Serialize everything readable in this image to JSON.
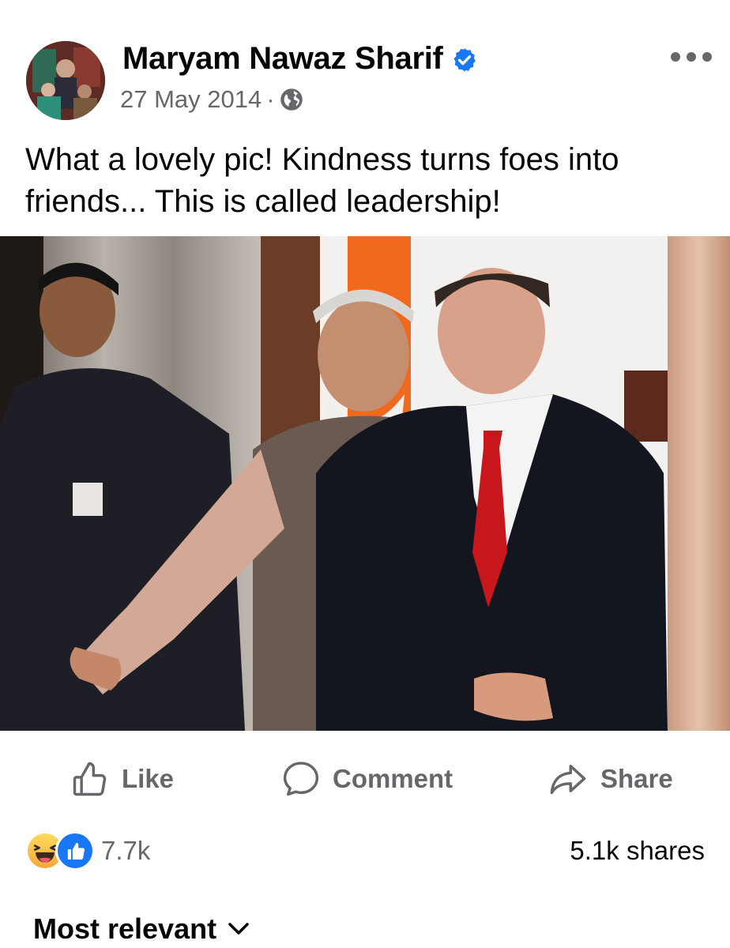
{
  "post": {
    "author": "Maryam Nawaz Sharif",
    "date": "27 May 2014",
    "separator": "·",
    "audience_icon": "globe-icon",
    "verified_icon": "verified-badge-icon",
    "caption": "What a lovely pic! Kindness turns foes into friends... This is called leadership!"
  },
  "actions": {
    "like_label": "Like",
    "comment_label": "Comment",
    "share_label": "Share"
  },
  "stats": {
    "reaction_icons": [
      "haha-reaction-icon",
      "like-reaction-icon"
    ],
    "reaction_count": "7.7k",
    "shares": "5.1k shares"
  },
  "comments": {
    "sort_label": "Most relevant"
  },
  "colors": {
    "accent": "#1877f2",
    "secondary_text": "#65676b",
    "primary_text": "#050505"
  }
}
